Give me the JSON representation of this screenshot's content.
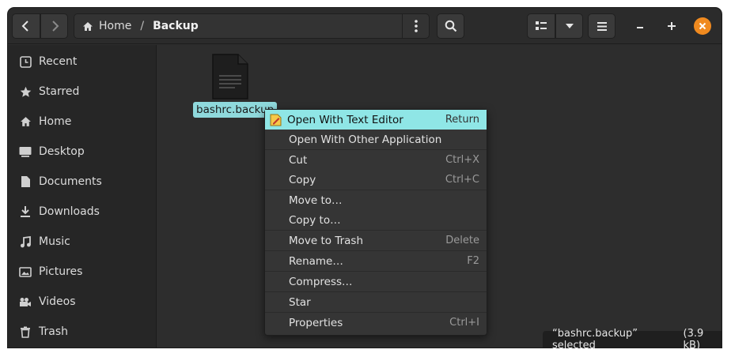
{
  "header": {
    "path": [
      {
        "label": "Home",
        "icon": "home-icon"
      },
      {
        "label": "Backup"
      }
    ],
    "path_separator": "/"
  },
  "sidebar": {
    "items": [
      {
        "label": "Recent",
        "icon": "recent-icon"
      },
      {
        "label": "Starred",
        "icon": "star-icon"
      },
      {
        "label": "Home",
        "icon": "home-icon"
      },
      {
        "label": "Desktop",
        "icon": "desktop-icon"
      },
      {
        "label": "Documents",
        "icon": "document-icon"
      },
      {
        "label": "Downloads",
        "icon": "download-icon"
      },
      {
        "label": "Music",
        "icon": "music-icon"
      },
      {
        "label": "Pictures",
        "icon": "picture-icon"
      },
      {
        "label": "Videos",
        "icon": "video-icon"
      },
      {
        "label": "Trash",
        "icon": "trash-icon"
      }
    ]
  },
  "content": {
    "file": {
      "name": "bashrc.backup",
      "icon": "text-file-icon"
    }
  },
  "context_menu": {
    "items": [
      {
        "label": "Open With Text Editor",
        "accel": "Return",
        "highlighted": true,
        "icon": "text-editor-icon"
      },
      {
        "label": "Open With Other Application",
        "accel": ""
      },
      {
        "label": "Cut",
        "accel": "Ctrl+X"
      },
      {
        "label": "Copy",
        "accel": "Ctrl+C"
      },
      {
        "label": "Move to…",
        "accel": ""
      },
      {
        "label": "Copy to…",
        "accel": ""
      },
      {
        "label": "Move to Trash",
        "accel": "Delete"
      },
      {
        "label": "Rename…",
        "accel": "F2"
      },
      {
        "label": "Compress…",
        "accel": ""
      },
      {
        "label": "Star",
        "accel": ""
      },
      {
        "label": "Properties",
        "accel": "Ctrl+I"
      }
    ]
  },
  "status": {
    "selection": "“bashrc.backup” selected",
    "size": "(3.9 kB)"
  },
  "colors": {
    "accent": "#8fe6e6",
    "close": "#f08a1f",
    "background": "#2d2d2d"
  }
}
